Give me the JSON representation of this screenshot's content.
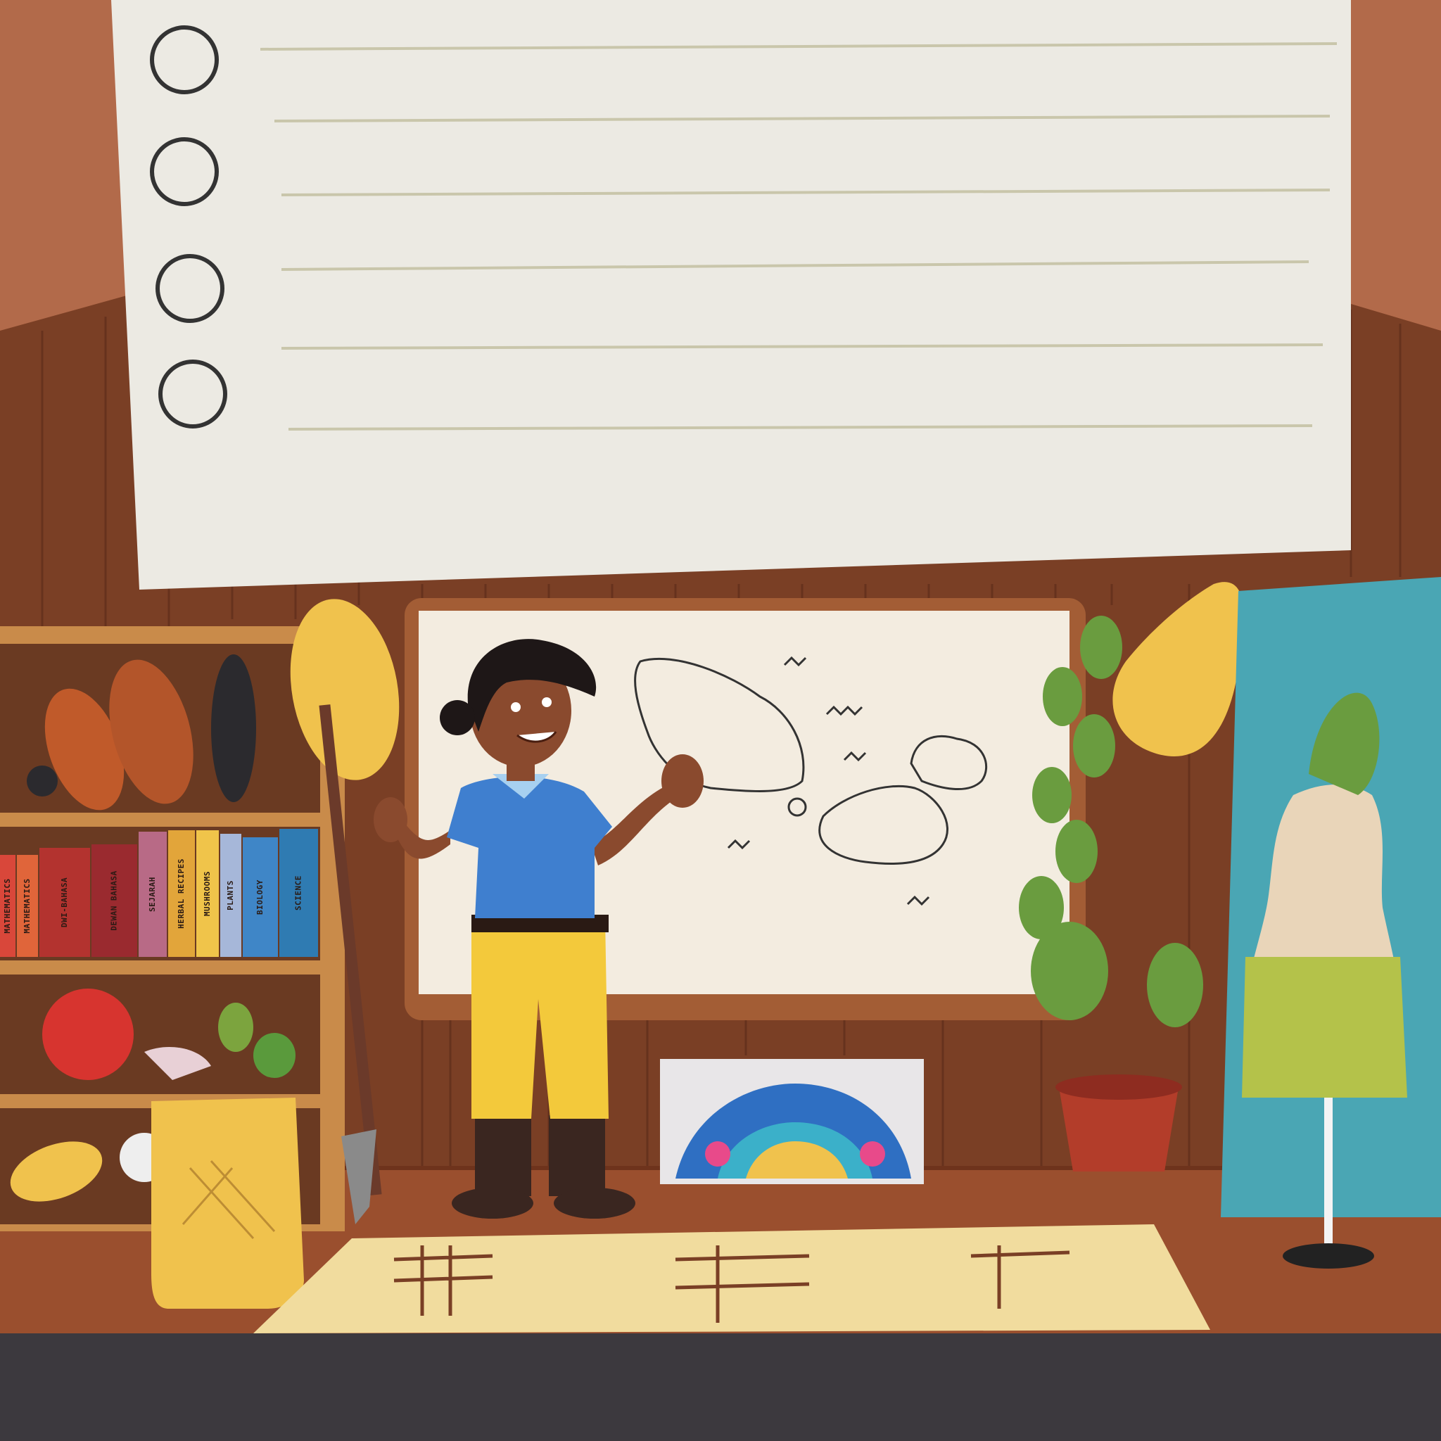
{
  "colors": {
    "wall_top": "#b26a4a",
    "wood_panel": "#7a3f25",
    "wood_line": "#5e2d1a",
    "floor": "#9a4f2e",
    "floor_bottom": "#3c393e",
    "paper": "#eceae3",
    "paper_line": "#c9c6ab",
    "shirt": "#3f7fcf",
    "pants": "#f3c93b",
    "boots": "#3a2620",
    "skin": "#8a4a2e",
    "hair": "#1e1717",
    "whiteboard": "#f3ece0",
    "shelf": "#c98b4a",
    "weave": "#f0c24d",
    "cabinet": "#4aa6b4",
    "plant": "#6a9c3f",
    "pot": "#b33d2a"
  },
  "books": [
    {
      "label": "MATHEMATICS",
      "color": "#d9473a"
    },
    {
      "label": "MATHEMATICS",
      "color": "#e0653a"
    },
    {
      "label": "DWI-BAHASA",
      "color": "#b3332f"
    },
    {
      "label": "DEWAN BAHASA",
      "color": "#9a2a2f"
    },
    {
      "label": "SEJARAH",
      "color": "#b86a86"
    },
    {
      "label": "HERBAL RECIPES",
      "color": "#e2a53a"
    },
    {
      "label": "MUSHROOMS",
      "color": "#f0c44a"
    },
    {
      "label": "PLANTS",
      "color": "#a6b7d9"
    },
    {
      "label": "BIOLOGY",
      "color": "#3f86c7"
    },
    {
      "label": "SCIENCE",
      "color": "#2f7bb2"
    }
  ],
  "icons": [
    "notebook-paper-icon",
    "binder-ring-icon",
    "bookshelf-icon",
    "whiteboard-map-icon",
    "woven-hat-icon",
    "potted-plant-icon",
    "mannequin-icon",
    "woven-basket-icon",
    "woven-rug-icon",
    "teacher-figure-icon"
  ]
}
